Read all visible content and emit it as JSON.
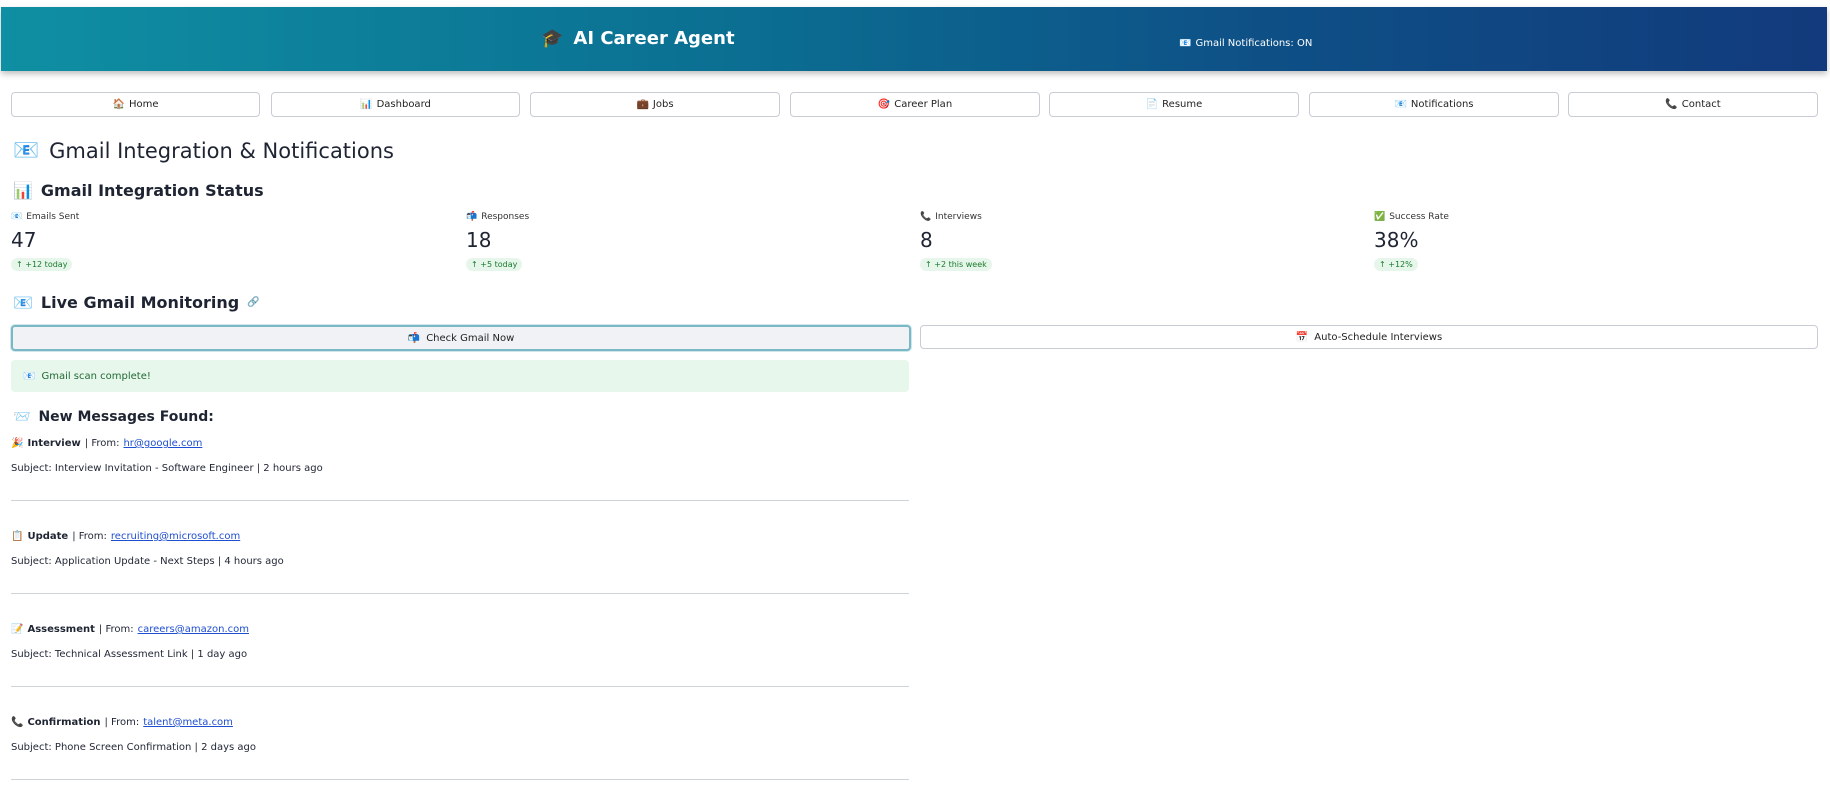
{
  "header": {
    "title": "AI Career Agent",
    "status": "Gmail Notifications: ON"
  },
  "nav": [
    {
      "icon": "🏠",
      "label": "Home"
    },
    {
      "icon": "📊",
      "label": "Dashboard"
    },
    {
      "icon": "💼",
      "label": "Jobs"
    },
    {
      "icon": "🎯",
      "label": "Career Plan"
    },
    {
      "icon": "📄",
      "label": "Resume"
    },
    {
      "icon": "📧",
      "label": "Notifications"
    },
    {
      "icon": "📞",
      "label": "Contact"
    }
  ],
  "page": {
    "title": "Gmail Integration & Notifications"
  },
  "status_section": {
    "title": "Gmail Integration Status"
  },
  "metrics": [
    {
      "label": "Emails Sent",
      "value": "47",
      "delta": "+12 today"
    },
    {
      "label": "Responses",
      "value": "18",
      "delta": "+5 today"
    },
    {
      "label": "Interviews",
      "value": "8",
      "delta": "+2 this week"
    },
    {
      "label": "Success Rate",
      "value": "38%",
      "delta": "+12%"
    }
  ],
  "monitor": {
    "title": "Live Gmail Monitoring",
    "check_label": "Check Gmail Now",
    "schedule_label": "Auto-Schedule Interviews"
  },
  "alert": {
    "text": "Gmail scan complete!"
  },
  "messages_title": "New Messages Found:",
  "messages": [
    {
      "type": "Interview",
      "from_prefix": " | From: ",
      "email": "hr@google.com",
      "subject": "Subject: Interview Invitation - Software Engineer | 2 hours ago"
    },
    {
      "type": "Update",
      "from_prefix": " | From: ",
      "email": "recruiting@microsoft.com",
      "subject": "Subject: Application Update - Next Steps | 4 hours ago"
    },
    {
      "type": "Assessment",
      "from_prefix": " | From: ",
      "email": "careers@amazon.com",
      "subject": "Subject: Technical Assessment Link | 1 day ago"
    },
    {
      "type": "Confirmation",
      "from_prefix": " | From: ",
      "email": "talent@meta.com",
      "subject": "Subject: Phone Screen Confirmation | 2 days ago"
    }
  ]
}
